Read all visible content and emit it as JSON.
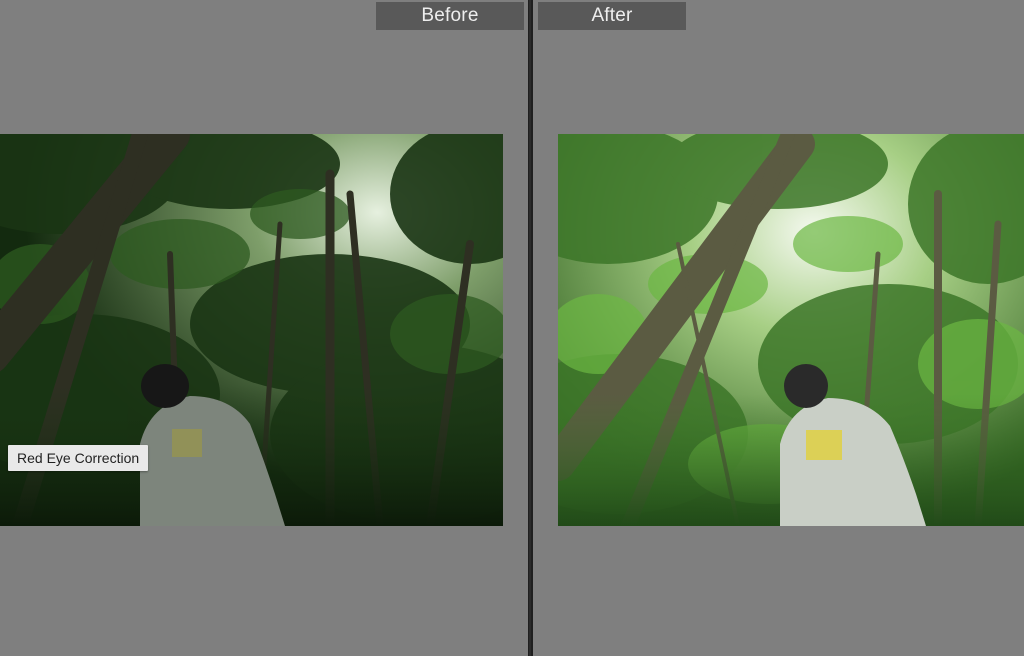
{
  "view": {
    "before_label": "Before",
    "after_label": "After"
  },
  "tooltip": {
    "text": "Red Eye Correction"
  },
  "photos": {
    "before": {
      "subject": "man-in-jungle",
      "tone": "dark",
      "colors": {
        "sky": "#cfe3c4",
        "canopy": "#1d3a16",
        "foliage": "#2c5a1f",
        "trunk": "#3a3a2c",
        "shirt": "#8a9189",
        "hair": "#1b1b1b"
      }
    },
    "after": {
      "subject": "man-in-jungle",
      "tone": "bright",
      "colors": {
        "sky": "#f3f8ee",
        "canopy": "#3f7a2a",
        "foliage": "#5fa83a",
        "trunk": "#6a6a4e",
        "shirt": "#c8cec5",
        "hair": "#2a2a2a"
      }
    }
  }
}
